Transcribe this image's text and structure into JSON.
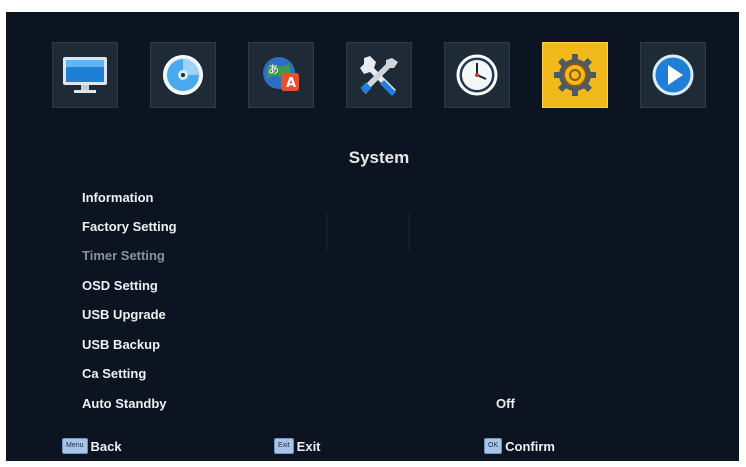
{
  "toolbar": {
    "icons": [
      {
        "name": "picture-icon"
      },
      {
        "name": "disc-icon"
      },
      {
        "name": "language-icon"
      },
      {
        "name": "tools-icon"
      },
      {
        "name": "clock-icon"
      },
      {
        "name": "system-gear-icon"
      },
      {
        "name": "play-icon"
      }
    ],
    "active_index": 5,
    "active_color": "#f2b91a"
  },
  "page": {
    "title": "System"
  },
  "menu": {
    "items": [
      {
        "label": "Information"
      },
      {
        "label": "Factory Setting"
      },
      {
        "label": "Timer Setting"
      },
      {
        "label": "OSD Setting"
      },
      {
        "label": "USB Upgrade"
      },
      {
        "label": "USB Backup"
      },
      {
        "label": "Ca Setting"
      },
      {
        "label": "Auto Standby",
        "value": "Off"
      }
    ],
    "dimmed_index": 2
  },
  "footer": {
    "back": {
      "key": "Menu",
      "label": "Back"
    },
    "exit": {
      "key": "Exit",
      "label": "Exit"
    },
    "confirm": {
      "key": "OK",
      "label": "Confirm"
    }
  }
}
